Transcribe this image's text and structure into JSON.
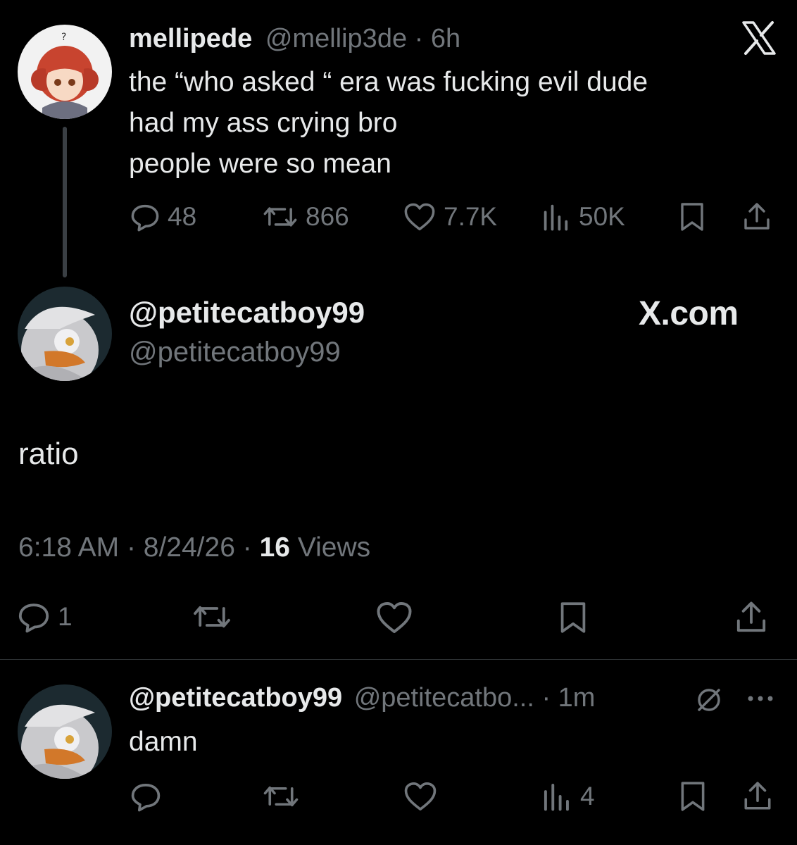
{
  "original_tweet": {
    "display_name": "mellipede",
    "handle": "@mellip3de",
    "separator": "·",
    "time_ago": "6h",
    "platform_mark": "X",
    "lines": [
      "the “who asked “ era was fucking evil dude",
      "had my ass crying bro",
      "people were so mean"
    ],
    "stats": {
      "replies": "48",
      "reposts": "866",
      "likes": "7.7K",
      "views": "50K"
    }
  },
  "reply_card": {
    "display_name": "@petitecatboy99",
    "handle": "@petitecatboy99",
    "site_logo": "X.com",
    "body": "ratio",
    "time": "6:18 AM",
    "sep1": "·",
    "date": "8/24/26",
    "sep2": "·",
    "views_count": "16",
    "views_label": "Views",
    "reply_count": "1"
  },
  "bottom_reply": {
    "display_name": "@petitecatboy99",
    "handle": "@petitecatbo...",
    "separator": "·",
    "time_ago": "1m",
    "body": "damn",
    "views": "4"
  },
  "icons": [
    "reply-icon",
    "repost-icon",
    "like-icon",
    "views-icon",
    "bookmark-icon",
    "share-icon",
    "x-logo-icon",
    "muted-circle-icon",
    "more-icon"
  ],
  "colors": {
    "background": "#000000",
    "text": "#e7e9ea",
    "muted": "#71767b",
    "thread_line": "#3a3f44"
  }
}
